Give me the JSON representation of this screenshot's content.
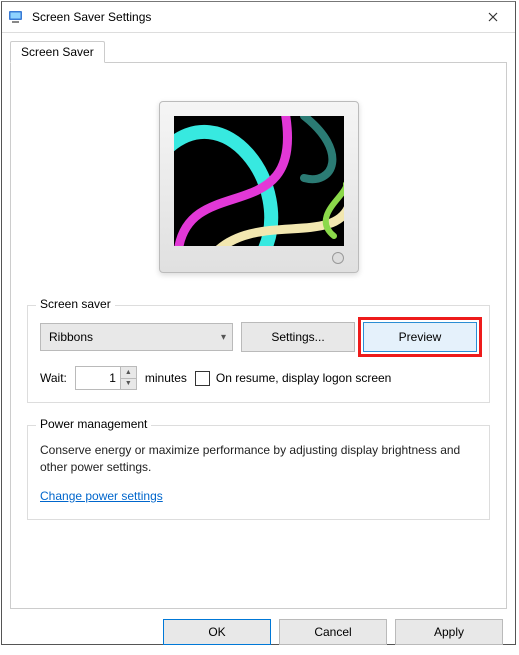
{
  "window": {
    "title": "Screen Saver Settings"
  },
  "tabs": {
    "screensaver_label": "Screen Saver"
  },
  "screensaver": {
    "group_label": "Screen saver",
    "combo_value": "Ribbons",
    "settings_btn": "Settings...",
    "preview_btn": "Preview",
    "wait_label": "Wait:",
    "wait_value": "1",
    "wait_units": "minutes",
    "resume_checkbox_label": "On resume, display logon screen"
  },
  "power": {
    "group_label": "Power management",
    "desc": "Conserve energy or maximize performance by adjusting display brightness and other power settings.",
    "link": "Change power settings"
  },
  "buttons": {
    "ok": "OK",
    "cancel": "Cancel",
    "apply": "Apply"
  }
}
